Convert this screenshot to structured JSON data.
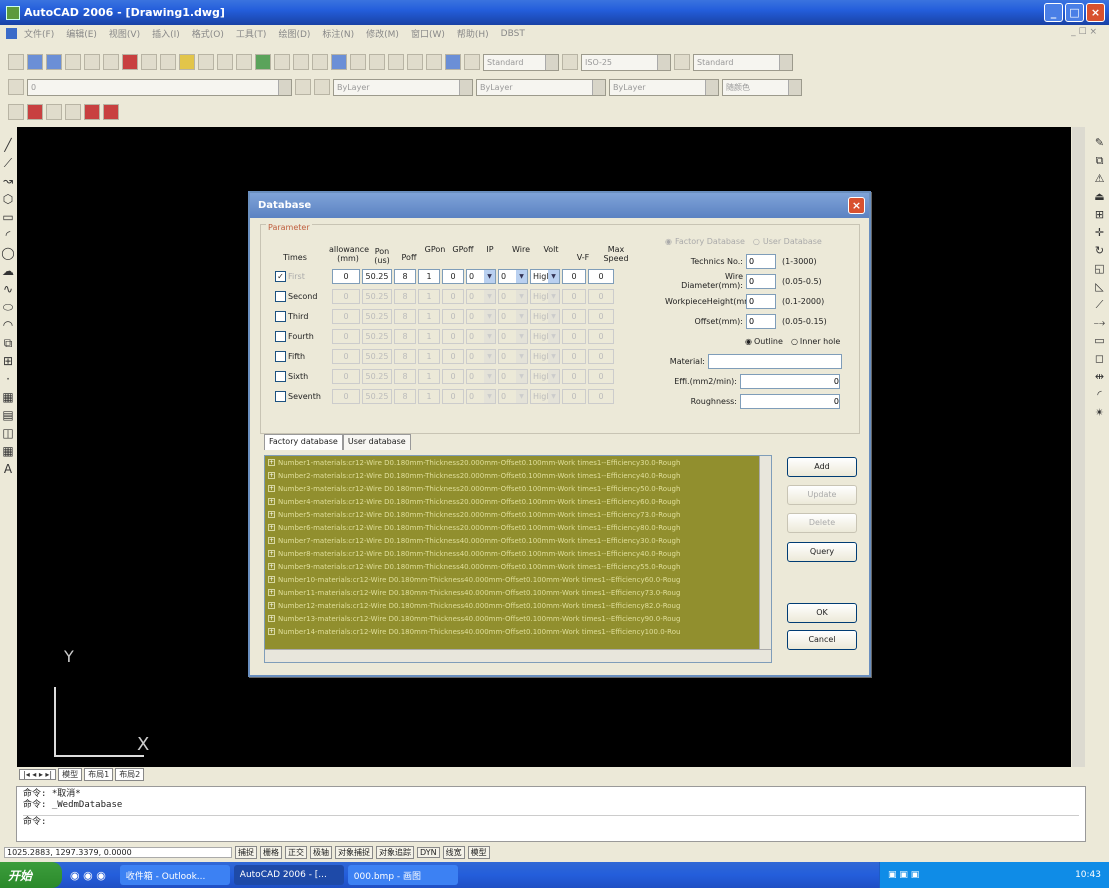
{
  "app": {
    "title": "AutoCAD 2006 - [Drawing1.dwg]",
    "menus": [
      "文件(F)",
      "编辑(E)",
      "视图(V)",
      "插入(I)",
      "格式(O)",
      "工具(T)",
      "绘图(D)",
      "标注(N)",
      "修改(M)",
      "窗口(W)",
      "帮助(H)",
      "DBST"
    ]
  },
  "toolbars": {
    "text_style": "Standard",
    "dim_style": "ISO-25",
    "table_style": "Standard",
    "layer": "0",
    "color": "ByLayer",
    "linetype": "ByLayer",
    "lineweight": "ByLayer",
    "plotstyle": "随颜色"
  },
  "drawing": {
    "axis_y": "Y",
    "axis_x": "X",
    "tabs": [
      "模型",
      "布局1",
      "布局2"
    ]
  },
  "command": {
    "lines": [
      "命令: *取消*",
      "命令: _WedmDatabase"
    ],
    "prompt": "命令:"
  },
  "status": {
    "coords": "1025.2883, 1297.3379, 0.0000",
    "buttons": [
      "捕捉",
      "栅格",
      "正交",
      "极轴",
      "对象捕捉",
      "对象追踪",
      "DYN",
      "线宽",
      "模型"
    ]
  },
  "taskbar": {
    "start": "开始",
    "tasks": [
      "收件箱 - Outlook...",
      "AutoCAD 2006 - [...",
      "000.bmp - 画图"
    ],
    "clock": "10:43"
  },
  "dialog": {
    "title": "Database",
    "param_legend": "Parameter",
    "headers": [
      "Times",
      "allowance (mm)",
      "Pon (us)",
      "Poff",
      "GPon",
      "GPoff",
      "IP",
      "Wire",
      "Volt",
      "V-F",
      "Max Speed"
    ],
    "rows": [
      {
        "label": "First",
        "checked": true,
        "enabled": true,
        "allowance": "0",
        "pon": "50.25",
        "poff": "8",
        "gpon": "1",
        "gpoff": "0",
        "ip": "0",
        "wire": "0",
        "volt": "Higl",
        "vf": "0",
        "max": "0"
      },
      {
        "label": "Second",
        "checked": false,
        "enabled": false,
        "allowance": "0",
        "pon": "50.25",
        "poff": "8",
        "gpon": "1",
        "gpoff": "0",
        "ip": "0",
        "wire": "0",
        "volt": "Higl",
        "vf": "0",
        "max": "0"
      },
      {
        "label": "Third",
        "checked": false,
        "enabled": false,
        "allowance": "0",
        "pon": "50.25",
        "poff": "8",
        "gpon": "1",
        "gpoff": "0",
        "ip": "0",
        "wire": "0",
        "volt": "Higl",
        "vf": "0",
        "max": "0"
      },
      {
        "label": "Fourth",
        "checked": false,
        "enabled": false,
        "allowance": "0",
        "pon": "50.25",
        "poff": "8",
        "gpon": "1",
        "gpoff": "0",
        "ip": "0",
        "wire": "0",
        "volt": "Higl",
        "vf": "0",
        "max": "0"
      },
      {
        "label": "Fifth",
        "checked": false,
        "enabled": false,
        "allowance": "0",
        "pon": "50.25",
        "poff": "8",
        "gpon": "1",
        "gpoff": "0",
        "ip": "0",
        "wire": "0",
        "volt": "Higl",
        "vf": "0",
        "max": "0"
      },
      {
        "label": "Sixth",
        "checked": false,
        "enabled": false,
        "allowance": "0",
        "pon": "50.25",
        "poff": "8",
        "gpon": "1",
        "gpoff": "0",
        "ip": "0",
        "wire": "0",
        "volt": "Higl",
        "vf": "0",
        "max": "0"
      },
      {
        "label": "Seventh",
        "checked": false,
        "enabled": false,
        "allowance": "0",
        "pon": "50.25",
        "poff": "8",
        "gpon": "1",
        "gpoff": "0",
        "ip": "0",
        "wire": "0",
        "volt": "Higl",
        "vf": "0",
        "max": "0"
      }
    ],
    "right": {
      "factory_radio": "Factory Database",
      "user_radio": "User Database",
      "technics_label": "Technics No.:",
      "technics_value": "0",
      "technics_range": "(1-3000)",
      "wire_label": "Wire Diameter(mm):",
      "wire_value": "0",
      "wire_range": "(0.05-0.5)",
      "height_label": "WorkpieceHeight(mm):",
      "height_value": "0",
      "height_range": "(0.1-2000)",
      "offset_label": "Offset(mm):",
      "offset_value": "0",
      "offset_range": "(0.05-0.15)",
      "outline_radio": "Outline",
      "inner_radio": "Inner hole",
      "material_label": "Material:",
      "material_value": "",
      "effi_label": "Effi.(mm2/min):",
      "effi_value": "0",
      "rough_label": "Roughness:",
      "rough_value": "0"
    },
    "tabs": [
      "Factory database",
      "User database"
    ],
    "list": [
      "Number1-materials:cr12-Wire D0.180mm-Thickness20.000mm-Offset0.100mm-Work times1--Efficiency30.0-Rough",
      "Number2-materials:cr12-Wire D0.180mm-Thickness20.000mm-Offset0.100mm-Work times1--Efficiency40.0-Rough",
      "Number3-materials:cr12-Wire D0.180mm-Thickness20.000mm-Offset0.100mm-Work times1--Efficiency50.0-Rough",
      "Number4-materials:cr12-Wire D0.180mm-Thickness20.000mm-Offset0.100mm-Work times1--Efficiency60.0-Rough",
      "Number5-materials:cr12-Wire D0.180mm-Thickness20.000mm-Offset0.100mm-Work times1--Efficiency73.0-Rough",
      "Number6-materials:cr12-Wire D0.180mm-Thickness20.000mm-Offset0.100mm-Work times1--Efficiency80.0-Rough",
      "Number7-materials:cr12-Wire D0.180mm-Thickness40.000mm-Offset0.100mm-Work times1--Efficiency30.0-Rough",
      "Number8-materials:cr12-Wire D0.180mm-Thickness40.000mm-Offset0.100mm-Work times1--Efficiency40.0-Rough",
      "Number9-materials:cr12-Wire D0.180mm-Thickness40.000mm-Offset0.100mm-Work times1--Efficiency55.0-Rough",
      "Number10-materials:cr12-Wire D0.180mm-Thickness40.000mm-Offset0.100mm-Work times1--Efficiency60.0-Roug",
      "Number11-materials:cr12-Wire D0.180mm-Thickness40.000mm-Offset0.100mm-Work times1--Efficiency73.0-Roug",
      "Number12-materials:cr12-Wire D0.180mm-Thickness40.000mm-Offset0.100mm-Work times1--Efficiency82.0-Roug",
      "Number13-materials:cr12-Wire D0.180mm-Thickness40.000mm-Offset0.100mm-Work times1--Efficiency90.0-Roug",
      "Number14-materials:cr12-Wire D0.180mm-Thickness40.000mm-Offset0.100mm-Work times1--Efficiency100.0-Rou"
    ],
    "buttons": {
      "add": "Add",
      "update": "Update",
      "delete": "Delete",
      "query": "Query",
      "ok": "OK",
      "cancel": "Cancel"
    }
  }
}
